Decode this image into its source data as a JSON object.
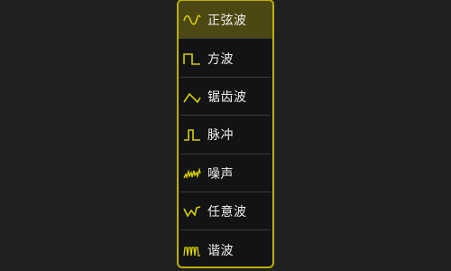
{
  "menu": {
    "selected_index": 0,
    "accent_color": "#b9b100",
    "items": [
      {
        "label": "正弦波",
        "icon": "sine-wave-icon"
      },
      {
        "label": "方波",
        "icon": "square-wave-icon"
      },
      {
        "label": "锯齿波",
        "icon": "sawtooth-wave-icon"
      },
      {
        "label": "脉冲",
        "icon": "pulse-wave-icon"
      },
      {
        "label": "噪声",
        "icon": "noise-wave-icon"
      },
      {
        "label": "任意波",
        "icon": "arbitrary-wave-icon"
      },
      {
        "label": "谐波",
        "icon": "harmonic-wave-icon"
      }
    ]
  }
}
